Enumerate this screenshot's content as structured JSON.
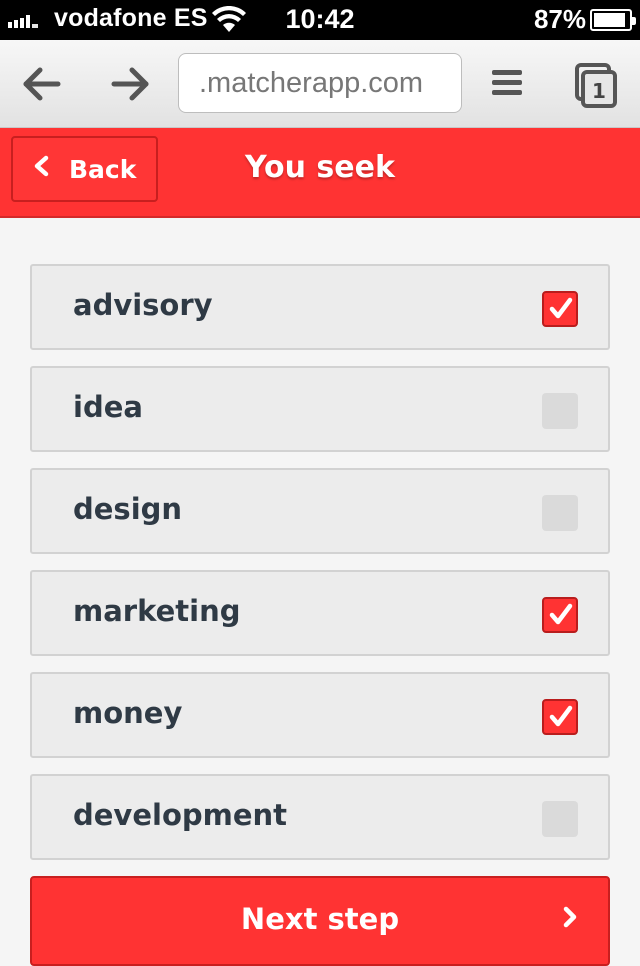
{
  "status_bar": {
    "carrier": "vodafone ES",
    "time": "10:42",
    "battery": "87%",
    "battery_level": 0.87,
    "signal_bars": 5
  },
  "browser": {
    "url": ".matcherapp.com",
    "icons": [
      "back-arrow-icon",
      "forward-arrow-icon",
      "menu-icon",
      "tabs-icon"
    ],
    "tab_count": "1"
  },
  "header": {
    "back_label": "Back",
    "title": "You seek",
    "accent_color": "#ff3333"
  },
  "options": [
    {
      "label": "advisory",
      "checked": true
    },
    {
      "label": "idea",
      "checked": false
    },
    {
      "label": "design",
      "checked": false
    },
    {
      "label": "marketing",
      "checked": true
    },
    {
      "label": "money",
      "checked": true
    },
    {
      "label": "development",
      "checked": false
    }
  ],
  "footer": {
    "next_label": "Next step"
  }
}
